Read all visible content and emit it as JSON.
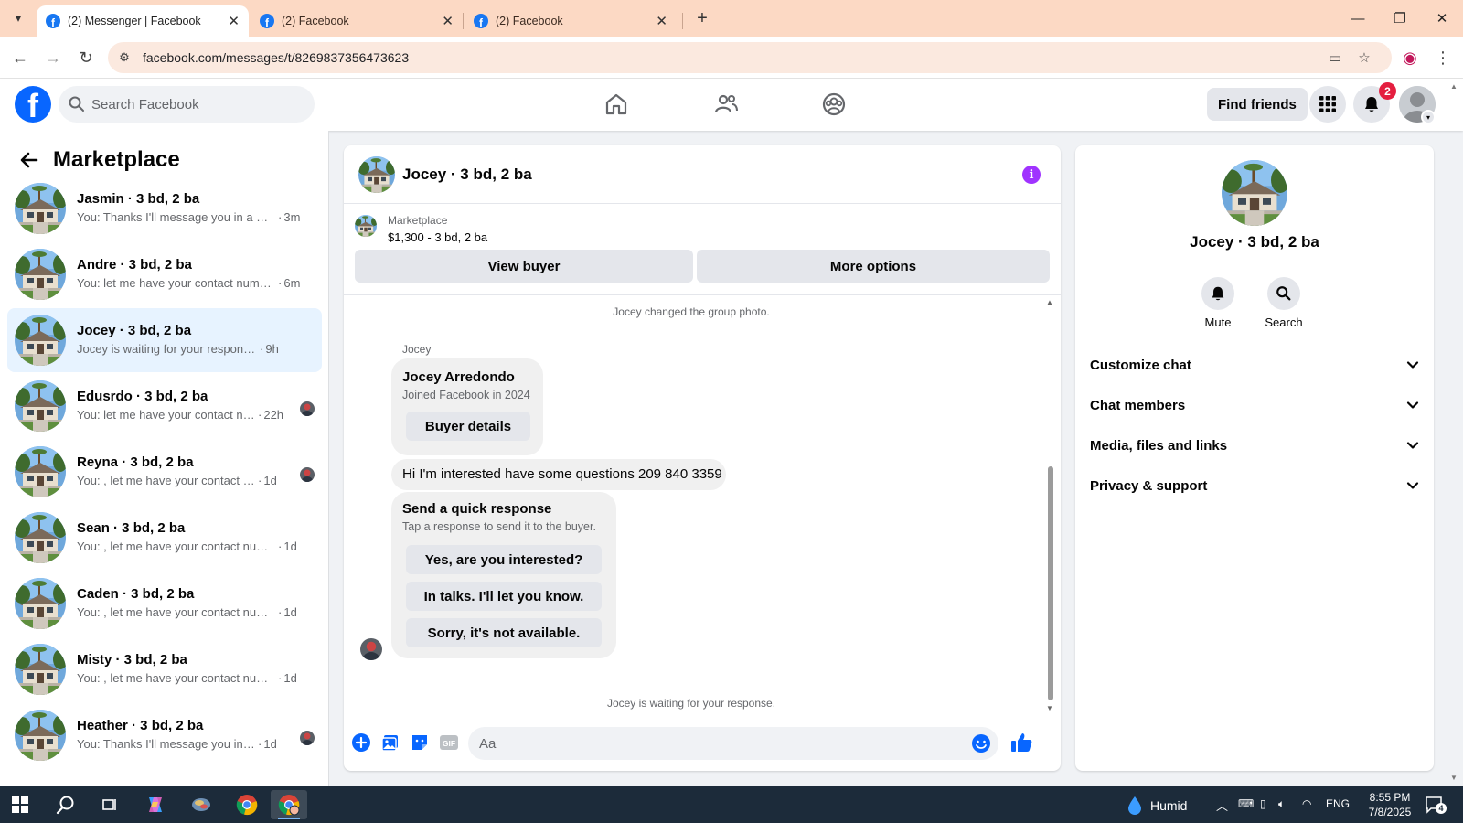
{
  "browser": {
    "tabs": [
      {
        "title": "(2) Messenger | Facebook",
        "active": true
      },
      {
        "title": "(2) Facebook",
        "active": false
      },
      {
        "title": "(2) Facebook",
        "active": false
      }
    ],
    "new_tab": "+",
    "url": "facebook.com/messages/t/8269837356473623"
  },
  "fb_nav": {
    "search_placeholder": "Search Facebook",
    "find_friends": "Find friends",
    "notification_count": "2"
  },
  "sidebar": {
    "title": "Marketplace",
    "conversations": [
      {
        "name": "Jasmin · 3 bd, 2 ba",
        "preview": "You: Thanks I'll message you in a mo...",
        "time": "3m",
        "active": false,
        "seen": false
      },
      {
        "name": "Andre · 3 bd, 2 ba",
        "preview": "You: let me have your contact numbe...",
        "time": "6m",
        "active": false,
        "seen": false
      },
      {
        "name": "Jocey · 3 bd, 2 ba",
        "preview": "Jocey is waiting for your response.",
        "time": "9h",
        "active": true,
        "seen": false
      },
      {
        "name": "Edusrdo · 3 bd, 2 ba",
        "preview": "You: let me have your contact nu...",
        "time": "22h",
        "active": false,
        "seen": true
      },
      {
        "name": "Reyna · 3 bd, 2 ba",
        "preview": "You: , let me have your contact nu...",
        "time": "1d",
        "active": false,
        "seen": true
      },
      {
        "name": "Sean · 3 bd, 2 ba",
        "preview": "You: , let me have your contact numb...",
        "time": "1d",
        "active": false,
        "seen": false
      },
      {
        "name": "Caden · 3 bd, 2 ba",
        "preview": "You: , let me have your contact numb...",
        "time": "1d",
        "active": false,
        "seen": false
      },
      {
        "name": "Misty · 3 bd, 2 ba",
        "preview": "You: , let me have your contact numb...",
        "time": "1d",
        "active": false,
        "seen": false
      },
      {
        "name": "Heather · 3 bd, 2 ba",
        "preview": "You: Thanks I'll message you in a ...",
        "time": "1d",
        "active": false,
        "seen": true
      }
    ]
  },
  "chat": {
    "title": "Jocey · 3 bd, 2 ba",
    "listing": {
      "label": "Marketplace",
      "price_line": "$1,300 - 3 bd, 2 ba",
      "view_buyer": "View buyer",
      "more_options": "More options"
    },
    "system_top": "Jocey changed the group photo.",
    "sender": "Jocey",
    "buyer_card": {
      "name": "Jocey Arredondo",
      "joined": "Joined Facebook in 2024",
      "button": "Buyer details"
    },
    "message": "Hi I'm interested have some questions 209 840 3359",
    "quick_response": {
      "title": "Send a quick response",
      "subtitle": "Tap a response to send it to the buyer.",
      "options": [
        "Yes, are you interested?",
        "In talks. I'll let you know.",
        "Sorry, it's not available."
      ]
    },
    "system_bottom": "Jocey is waiting for your response.",
    "composer_placeholder": "Aa"
  },
  "right_panel": {
    "name": "Jocey · 3 bd, 2 ba",
    "actions": [
      {
        "label": "Mute",
        "icon": "bell-icon"
      },
      {
        "label": "Search",
        "icon": "search-icon"
      }
    ],
    "sections": [
      "Customize chat",
      "Chat members",
      "Media, files and links",
      "Privacy & support"
    ]
  },
  "taskbar": {
    "weather": "Humid",
    "language": "ENG",
    "time": "8:55 PM",
    "date": "7/8/2025",
    "notifications": "4"
  },
  "colors": {
    "fb_blue": "#0866ff",
    "active_conv": "#e7f3ff",
    "info_purple": "#a033ff",
    "badge_red": "#e41e3f",
    "tab_bar": "#fcd9c4"
  }
}
